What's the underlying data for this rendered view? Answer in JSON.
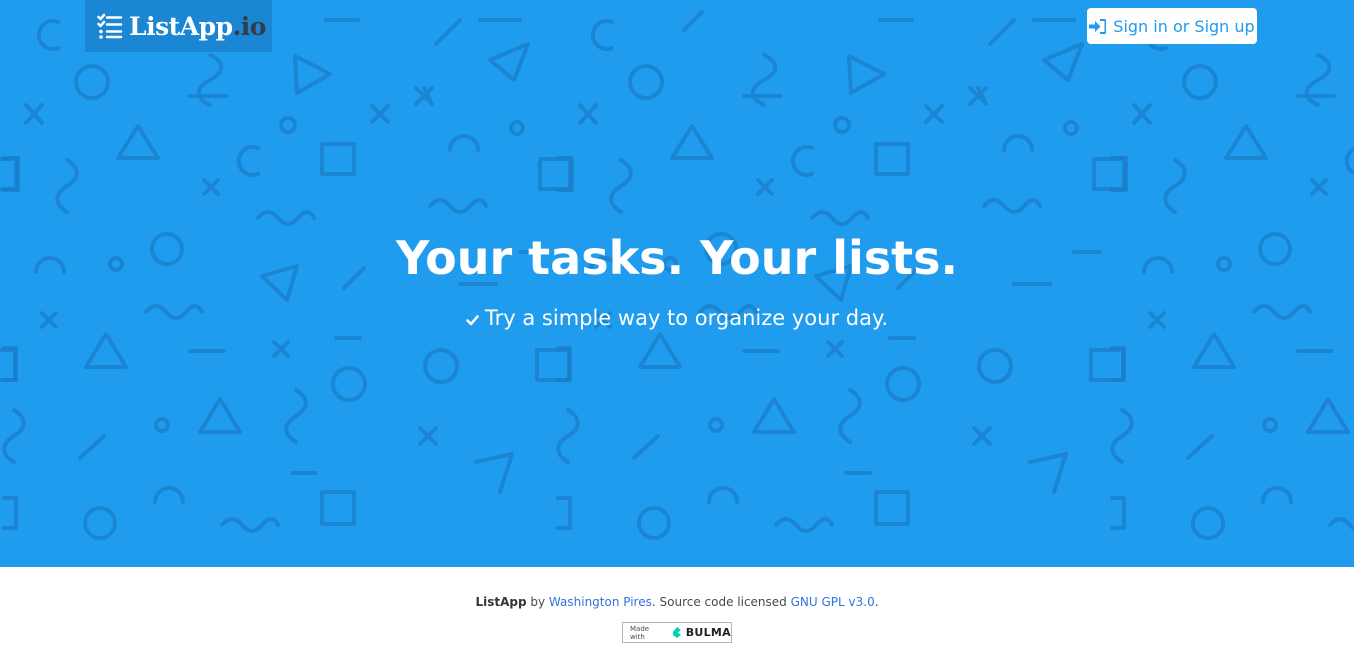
{
  "header": {
    "logo_name": "ListApp",
    "logo_tld": ".io",
    "signin_label": "Sign in or Sign up"
  },
  "hero": {
    "title": "Your tasks. Your lists.",
    "subtitle": "Try a simple way to organize your day."
  },
  "footer": {
    "app_name": "ListApp",
    "by_text": "by",
    "author": "Washington Pires",
    "license_text": ". Source code licensed",
    "license_link": "GNU GPL v3.0",
    "end_punct": ".",
    "badge_small": "Made with",
    "badge_big": "BULMA"
  },
  "colors": {
    "hero_bg": "#209cee",
    "logo_bg": "#1b86d3",
    "pattern": "#1a7ec9",
    "link": "#3273dc",
    "bulma": "#00d1b2"
  },
  "icons": {
    "logo": "list-icon",
    "signin": "sign-in-icon",
    "check": "check-icon",
    "bulma": "bulma-logo-icon"
  }
}
